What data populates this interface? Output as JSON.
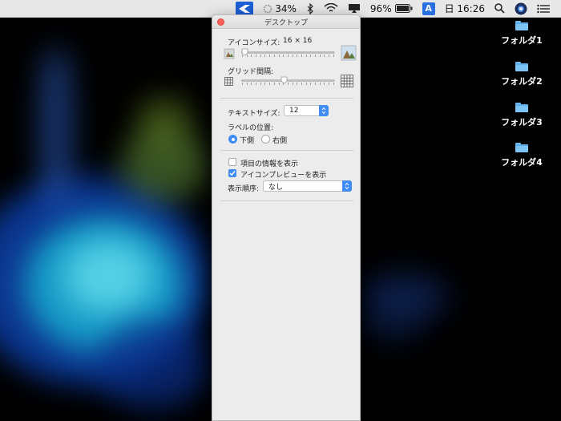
{
  "menubar": {
    "battery_cpu_label": "34%",
    "battery_label": "96%",
    "input_source": "A",
    "clock": "日 16:26",
    "icons": [
      "app-icon",
      "cpu-ring-icon",
      "bluetooth-icon",
      "wifi-icon",
      "airplay-icon",
      "battery-icon",
      "input-source-icon",
      "spotlight-search-icon",
      "user-avatar-icon",
      "notification-center-icon"
    ]
  },
  "desktop": {
    "folders": [
      {
        "label": "フォルダ1"
      },
      {
        "label": "フォルダ2"
      },
      {
        "label": "フォルダ3"
      },
      {
        "label": "フォルダ4"
      }
    ]
  },
  "panel": {
    "title": "デスクトップ",
    "icon_size_label": "アイコンサイズ:",
    "icon_size_value": "16 × 16",
    "icon_size_slider": 0.0,
    "grid_spacing_label": "グリッド間隔:",
    "grid_spacing_slider": 0.45,
    "text_size_label": "テキストサイズ:",
    "text_size_value": "12",
    "label_position_label": "ラベルの位置:",
    "label_position_options": {
      "bottom": "下側",
      "right": "右側"
    },
    "label_position_selected": "bottom",
    "show_item_info_label": "項目の情報を表示",
    "show_item_info_checked": false,
    "show_icon_preview_label": "アイコンプレビューを表示",
    "show_icon_preview_checked": true,
    "sort_by_label": "表示順序:",
    "sort_by_value": "なし"
  },
  "colors": {
    "accent": "#3f8cf5",
    "close": "#fc5f57",
    "folder": "#5aaeea"
  }
}
